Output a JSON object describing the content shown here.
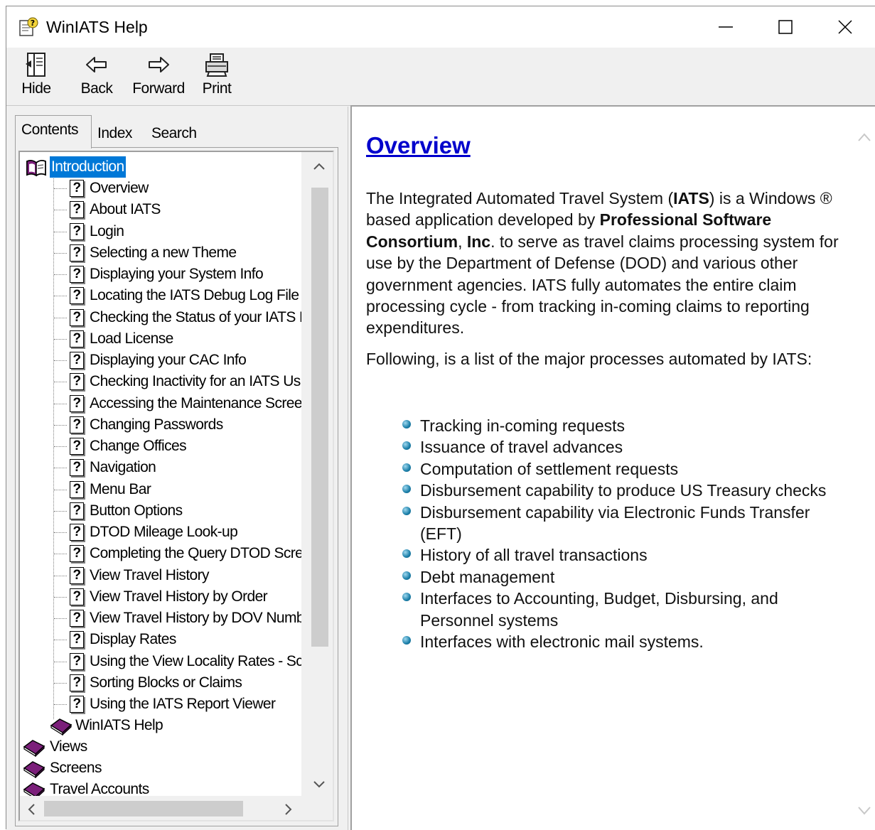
{
  "window": {
    "title": "WinIATS Help",
    "controls": [
      "minimize-icon",
      "maximize-icon",
      "close-icon"
    ]
  },
  "toolbar": {
    "hide_label": "Hide",
    "back_label": "Back",
    "forward_label": "Forward",
    "print_label": "Print"
  },
  "tabs": {
    "contents": "Contents",
    "index": "Index",
    "search": "Search",
    "active": "Contents"
  },
  "tree": {
    "root": {
      "label": "Introduction",
      "icon": "open-book-icon",
      "selected": true
    },
    "topics": [
      "Overview",
      "About IATS",
      "Login",
      "Selecting a new Theme",
      "Displaying your System Info",
      "Locating the IATS Debug Log File",
      "Checking the Status of your IATS L",
      "Load License",
      "Displaying your CAC Info",
      "Checking Inactivity for an IATS Us",
      "Accessing the Maintenance Screen",
      "Changing Passwords",
      "Change Offices",
      "Navigation",
      "Menu Bar",
      "Button Options",
      "DTOD Mileage Look-up",
      "Completing the Query DTOD Scree",
      "View Travel History",
      "View Travel History by Order",
      "View Travel History by DOV Numbe",
      "Display Rates",
      "Using the View Locality Rates - Scr",
      "Sorting Blocks or Claims",
      "Using the IATS Report Viewer"
    ],
    "sub_book": "WinIATS Help",
    "books": [
      "Views",
      "Screens",
      "Travel Accounts"
    ]
  },
  "content": {
    "title": "Overview",
    "p1": [
      {
        "t": "The Integrated Automated Travel System (",
        "b": false
      },
      {
        "t": "IATS",
        "b": true
      },
      {
        "t": ") is a Windows ® based application developed by ",
        "b": false
      },
      {
        "t": "Professional Software Consortium",
        "b": true
      },
      {
        "t": ", ",
        "b": false
      },
      {
        "t": "Inc",
        "b": true
      },
      {
        "t": ". to serve as travel claims processing system for use by the Department of Defense (DOD) and various other government agencies. IATS fully automates the entire claim processing cycle - from tracking in-coming claims to reporting expenditures.",
        "b": false
      }
    ],
    "p2": "Following, is a list of the major processes automated by IATS:",
    "bullets": [
      "Tracking in-coming requests",
      "Issuance of travel advances",
      "Computation of settlement requests",
      "Disbursement capability to produce US Treasury checks",
      "Disbursement capability via Electronic Funds Transfer (EFT)",
      "History of all travel transactions",
      "Debt management",
      "Interfaces to Accounting, Budget, Disbursing, and Personnel systems",
      "Interfaces with electronic mail systems."
    ]
  },
  "colors": {
    "selection": "#0078d7",
    "link_title": "#0000cc",
    "book": "#7b1f7a"
  }
}
